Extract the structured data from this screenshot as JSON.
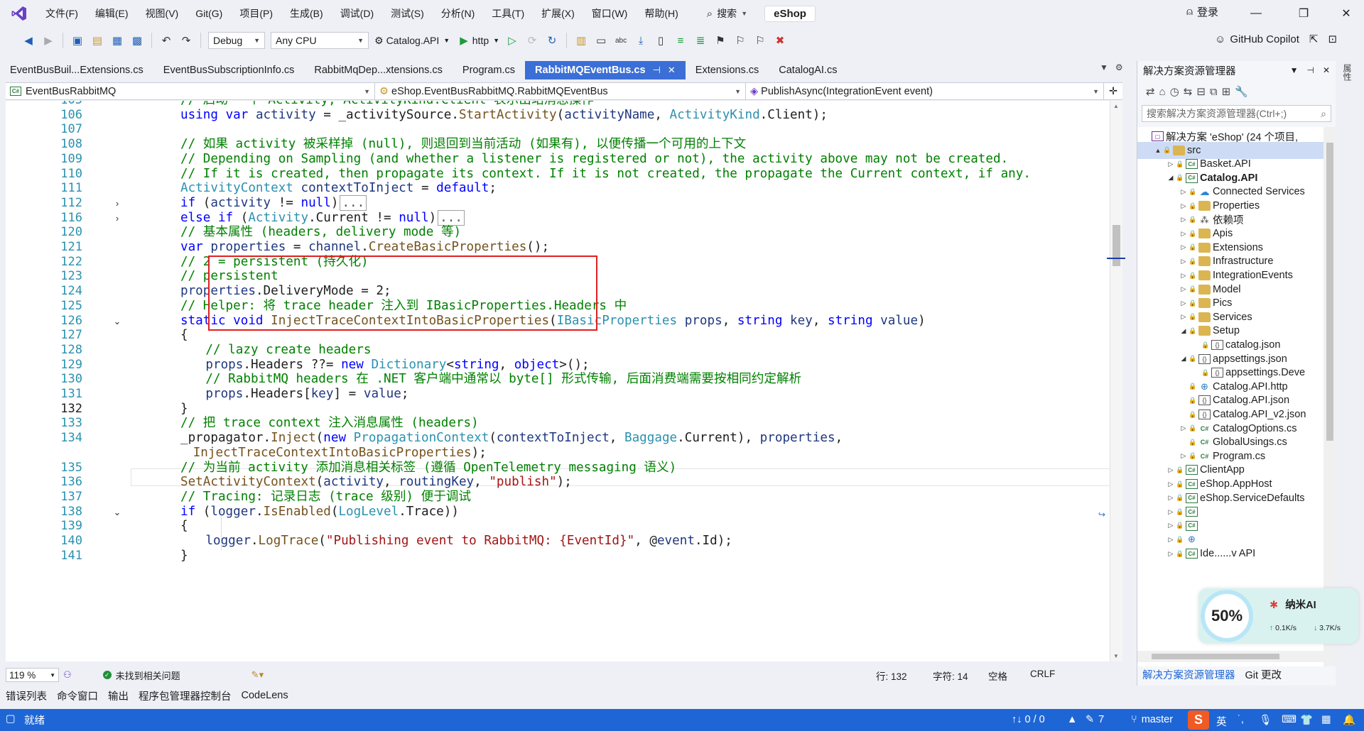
{
  "menu": [
    "文件(F)",
    "编辑(E)",
    "视图(V)",
    "Git(G)",
    "项目(P)",
    "生成(B)",
    "调试(D)",
    "测试(S)",
    "分析(N)",
    "工具(T)",
    "扩展(X)",
    "窗口(W)",
    "帮助(H)"
  ],
  "search_label": "搜索",
  "solution_name": "eShop",
  "login_label": "登录",
  "toolbar": {
    "config": "Debug",
    "platform": "Any CPU",
    "startup_project": "Catalog.API",
    "launch_profile": "http",
    "copilot_label": "GitHub Copilot"
  },
  "tabs": [
    {
      "label": "EventBusBuil...Extensions.cs",
      "active": false
    },
    {
      "label": "EventBusSubscriptionInfo.cs",
      "active": false
    },
    {
      "label": "RabbitMqDep...xtensions.cs",
      "active": false
    },
    {
      "label": "Program.cs",
      "active": false
    },
    {
      "label": "RabbitMQEventBus.cs",
      "active": true
    },
    {
      "label": "Extensions.cs",
      "active": false
    },
    {
      "label": "CatalogAI.cs",
      "active": false
    }
  ],
  "navbar": {
    "project": "EventBusRabbitMQ",
    "type": "eShop.EventBusRabbitMQ.RabbitMQEventBus",
    "member": "PublishAsync(IntegrationEvent event)"
  },
  "code_lines": [
    {
      "n": "105",
      "indent": 8,
      "fold": "",
      "tokens": [
        [
          "com",
          "// 启动 一个 Activity, ActivityKind.Client 表示出站消息操作"
        ]
      ]
    },
    {
      "n": "106",
      "indent": 8,
      "fold": "",
      "tokens": [
        [
          "kw",
          "using "
        ],
        [
          "kw",
          "var "
        ],
        [
          "var",
          "activity"
        ],
        [
          "plain",
          " = _activitySource."
        ],
        [
          "meth",
          "StartActivity"
        ],
        [
          "plain",
          "("
        ],
        [
          "var",
          "activityName"
        ],
        [
          "plain",
          ", "
        ],
        [
          "type",
          "ActivityKind"
        ],
        [
          "plain",
          ".Client);"
        ]
      ]
    },
    {
      "n": "107",
      "indent": 8,
      "fold": "",
      "tokens": []
    },
    {
      "n": "108",
      "indent": 8,
      "fold": "",
      "tokens": [
        [
          "com",
          "// 如果 activity 被采样掉 (null), 则退回到当前活动 (如果有), 以便传播一个可用的上下文"
        ]
      ]
    },
    {
      "n": "109",
      "indent": 8,
      "fold": "",
      "tokens": [
        [
          "com",
          "// Depending on Sampling (and whether a listener is registered or not), the activity above may not be created."
        ]
      ]
    },
    {
      "n": "110",
      "indent": 8,
      "fold": "",
      "tokens": [
        [
          "com",
          "// If it is created, then propagate its context. If it is not created, the propagate the Current context, if any."
        ]
      ]
    },
    {
      "n": "111",
      "indent": 8,
      "fold": "",
      "tokens": [
        [
          "type",
          "ActivityContext "
        ],
        [
          "var",
          "contextToInject"
        ],
        [
          "plain",
          " = "
        ],
        [
          "kw",
          "default"
        ],
        [
          "plain",
          ";"
        ]
      ]
    },
    {
      "n": "112",
      "indent": 8,
      "fold": "collapsed",
      "tokens": [
        [
          "kw",
          "if "
        ],
        [
          "plain",
          "("
        ],
        [
          "var",
          "activity"
        ],
        [
          "plain",
          " != "
        ],
        [
          "kw",
          "null"
        ],
        [
          "plain",
          ")"
        ],
        [
          "box",
          "..."
        ]
      ]
    },
    {
      "n": "116",
      "indent": 8,
      "fold": "collapsed",
      "tokens": [
        [
          "kw",
          "else if "
        ],
        [
          "plain",
          "("
        ],
        [
          "type",
          "Activity"
        ],
        [
          "plain",
          ".Current != "
        ],
        [
          "kw",
          "null"
        ],
        [
          "plain",
          ")"
        ],
        [
          "box",
          "..."
        ]
      ]
    },
    {
      "n": "120",
      "indent": 8,
      "fold": "",
      "tokens": [
        [
          "com",
          "// 基本属性 (headers, delivery mode 等)"
        ]
      ]
    },
    {
      "n": "121",
      "indent": 8,
      "fold": "",
      "tokens": [
        [
          "kw",
          "var "
        ],
        [
          "var",
          "properties"
        ],
        [
          "plain",
          " = "
        ],
        [
          "var",
          "channel"
        ],
        [
          "plain",
          "."
        ],
        [
          "meth",
          "CreateBasicProperties"
        ],
        [
          "plain",
          "();"
        ]
      ]
    },
    {
      "n": "122",
      "indent": 8,
      "fold": "",
      "tokens": [
        [
          "com",
          "// 2 = persistent (持久化)"
        ]
      ]
    },
    {
      "n": "123",
      "indent": 8,
      "fold": "",
      "tokens": [
        [
          "com",
          "// persistent"
        ]
      ]
    },
    {
      "n": "124",
      "indent": 8,
      "fold": "",
      "tokens": [
        [
          "var",
          "properties"
        ],
        [
          "plain",
          ".DeliveryMode = 2;"
        ]
      ]
    },
    {
      "n": "125",
      "indent": 8,
      "fold": "",
      "tokens": [
        [
          "com",
          "// Helper: 将 trace header 注入到 IBasicProperties.Headers 中"
        ]
      ]
    },
    {
      "n": "126",
      "indent": 8,
      "fold": "open",
      "tokens": [
        [
          "kw",
          "static "
        ],
        [
          "kw",
          "void "
        ],
        [
          "meth",
          "InjectTraceContextIntoBasicProperties"
        ],
        [
          "plain",
          "("
        ],
        [
          "type",
          "IBasicProperties "
        ],
        [
          "var",
          "props"
        ],
        [
          "plain",
          ", "
        ],
        [
          "kw",
          "string "
        ],
        [
          "var",
          "key"
        ],
        [
          "plain",
          ", "
        ],
        [
          "kw",
          "string "
        ],
        [
          "var",
          "value"
        ],
        [
          "plain",
          ")"
        ]
      ]
    },
    {
      "n": "127",
      "indent": 8,
      "fold": "",
      "tokens": [
        [
          "plain",
          "{"
        ]
      ]
    },
    {
      "n": "128",
      "indent": 12,
      "fold": "",
      "tokens": [
        [
          "com",
          "// lazy create headers"
        ]
      ]
    },
    {
      "n": "129",
      "indent": 12,
      "fold": "",
      "tokens": [
        [
          "var",
          "props"
        ],
        [
          "plain",
          ".Headers ??= "
        ],
        [
          "kw",
          "new "
        ],
        [
          "type",
          "Dictionary"
        ],
        [
          "plain",
          "<"
        ],
        [
          "kw",
          "string"
        ],
        [
          "plain",
          ", "
        ],
        [
          "kw",
          "object"
        ],
        [
          "plain",
          ">();"
        ]
      ]
    },
    {
      "n": "130",
      "indent": 12,
      "fold": "",
      "tokens": [
        [
          "com",
          "// RabbitMQ headers 在 .NET 客户端中通常以 byte[] 形式传输, 后面消费端需要按相同约定解析"
        ]
      ]
    },
    {
      "n": "131",
      "indent": 12,
      "fold": "",
      "tokens": [
        [
          "var",
          "props"
        ],
        [
          "plain",
          ".Headers["
        ],
        [
          "var",
          "key"
        ],
        [
          "plain",
          "] = "
        ],
        [
          "var",
          "value"
        ],
        [
          "plain",
          ";"
        ]
      ]
    },
    {
      "n": "132",
      "indent": 8,
      "fold": "",
      "current": true,
      "tokens": [
        [
          "plain",
          "}"
        ]
      ]
    },
    {
      "n": "133",
      "indent": 8,
      "fold": "",
      "tokens": [
        [
          "com",
          "// 把 trace context 注入消息属性 (headers)"
        ]
      ]
    },
    {
      "n": "134",
      "indent": 8,
      "fold": "",
      "tokens": [
        [
          "plain",
          "_propagator."
        ],
        [
          "meth",
          "Inject"
        ],
        [
          "plain",
          "("
        ],
        [
          "kw",
          "new "
        ],
        [
          "type",
          "PropagationContext"
        ],
        [
          "plain",
          "("
        ],
        [
          "var",
          "contextToInject"
        ],
        [
          "plain",
          ", "
        ],
        [
          "type",
          "Baggage"
        ],
        [
          "plain",
          ".Current), "
        ],
        [
          "var",
          "properties"
        ],
        [
          "plain",
          ","
        ]
      ]
    },
    {
      "n": "",
      "indent": 10,
      "fold": "",
      "tokens": [
        [
          "meth",
          "InjectTraceContextIntoBasicProperties"
        ],
        [
          "plain",
          ");"
        ]
      ]
    },
    {
      "n": "135",
      "indent": 8,
      "fold": "",
      "tokens": [
        [
          "com",
          "// 为当前 activity 添加消息相关标签 (遵循 OpenTelemetry messaging 语义)"
        ]
      ]
    },
    {
      "n": "136",
      "indent": 8,
      "fold": "",
      "tokens": [
        [
          "meth",
          "SetActivityContext"
        ],
        [
          "plain",
          "("
        ],
        [
          "var",
          "activity"
        ],
        [
          "plain",
          ", "
        ],
        [
          "var",
          "routingKey"
        ],
        [
          "plain",
          ", "
        ],
        [
          "str",
          "\"publish\""
        ],
        [
          "plain",
          ");"
        ]
      ]
    },
    {
      "n": "137",
      "indent": 8,
      "fold": "",
      "tokens": [
        [
          "com",
          "// Tracing: 记录日志 (trace 级别) 便于调试"
        ]
      ]
    },
    {
      "n": "138",
      "indent": 8,
      "fold": "open",
      "tokens": [
        [
          "kw",
          "if "
        ],
        [
          "plain",
          "("
        ],
        [
          "var",
          "logger"
        ],
        [
          "plain",
          "."
        ],
        [
          "meth",
          "IsEnabled"
        ],
        [
          "plain",
          "("
        ],
        [
          "type",
          "LogLevel"
        ],
        [
          "plain",
          ".Trace))"
        ]
      ]
    },
    {
      "n": "139",
      "indent": 8,
      "fold": "",
      "tokens": [
        [
          "plain",
          "{"
        ]
      ]
    },
    {
      "n": "140",
      "indent": 12,
      "fold": "",
      "tokens": [
        [
          "var",
          "logger"
        ],
        [
          "plain",
          "."
        ],
        [
          "meth",
          "LogTrace"
        ],
        [
          "plain",
          "("
        ],
        [
          "str",
          "\"Publishing event to RabbitMQ: {EventId}\""
        ],
        [
          "plain",
          ", @"
        ],
        [
          "var",
          "event"
        ],
        [
          "plain",
          ".Id);"
        ]
      ]
    },
    {
      "n": "141",
      "indent": 8,
      "fold": "",
      "tokens": [
        [
          "plain",
          "}"
        ]
      ]
    }
  ],
  "editor_status": {
    "zoom": "119 %",
    "issues": "未找到相关问题",
    "line": "行: 132",
    "char": "字符: 14",
    "whitespace": "空格",
    "eol": "CRLF"
  },
  "bottom_tabs": [
    "错误列表",
    "命令窗口",
    "输出",
    "程序包管理器控制台",
    "CodeLens"
  ],
  "statusbar": {
    "ready": "就绪",
    "sync": "↑↓ 0 / 0",
    "edits": "7",
    "branch": "master"
  },
  "solution_explorer": {
    "title": "解决方案资源管理器",
    "search_placeholder": "搜索解决方案资源管理器(Ctrl+;)",
    "items": [
      {
        "label": "解决方案 'eShop' (24 个项目,",
        "depth": 0,
        "arrow": "",
        "icon": "sln"
      },
      {
        "label": "src",
        "depth": 1,
        "arrow": "▲",
        "icon": "folder",
        "selected": true
      },
      {
        "label": "Basket.API",
        "depth": 2,
        "arrow": "▷",
        "icon": "project"
      },
      {
        "label": "Catalog.API",
        "depth": 2,
        "arrow": "◢",
        "icon": "project",
        "bold": true
      },
      {
        "label": "Connected Services",
        "depth": 3,
        "arrow": "▷",
        "icon": "conn"
      },
      {
        "label": "Properties",
        "depth": 3,
        "arrow": "▷",
        "icon": "folder"
      },
      {
        "label": "依赖项",
        "depth": 3,
        "arrow": "▷",
        "icon": "ref"
      },
      {
        "label": "Apis",
        "depth": 3,
        "arrow": "▷",
        "icon": "folder"
      },
      {
        "label": "Extensions",
        "depth": 3,
        "arrow": "▷",
        "icon": "folder"
      },
      {
        "label": "Infrastructure",
        "depth": 3,
        "arrow": "▷",
        "icon": "folder"
      },
      {
        "label": "IntegrationEvents",
        "depth": 3,
        "arrow": "▷",
        "icon": "folder"
      },
      {
        "label": "Model",
        "depth": 3,
        "arrow": "▷",
        "icon": "folder"
      },
      {
        "label": "Pics",
        "depth": 3,
        "arrow": "▷",
        "icon": "folder"
      },
      {
        "label": "Services",
        "depth": 3,
        "arrow": "▷",
        "icon": "folder"
      },
      {
        "label": "Setup",
        "depth": 3,
        "arrow": "◢",
        "icon": "folder"
      },
      {
        "label": "catalog.json",
        "depth": 4,
        "arrow": "",
        "icon": "json"
      },
      {
        "label": "appsettings.json",
        "depth": 3,
        "arrow": "◢",
        "icon": "json"
      },
      {
        "label": "appsettings.Deve",
        "depth": 4,
        "arrow": "",
        "icon": "json"
      },
      {
        "label": "Catalog.API.http",
        "depth": 3,
        "arrow": "",
        "icon": "globe"
      },
      {
        "label": "Catalog.API.json",
        "depth": 3,
        "arrow": "",
        "icon": "json"
      },
      {
        "label": "Catalog.API_v2.json",
        "depth": 3,
        "arrow": "",
        "icon": "json"
      },
      {
        "label": "CatalogOptions.cs",
        "depth": 3,
        "arrow": "▷",
        "icon": "cs"
      },
      {
        "label": "GlobalUsings.cs",
        "depth": 3,
        "arrow": "",
        "icon": "cs"
      },
      {
        "label": "Program.cs",
        "depth": 3,
        "arrow": "▷",
        "icon": "cs"
      },
      {
        "label": "ClientApp",
        "depth": 2,
        "arrow": "▷",
        "icon": "project"
      },
      {
        "label": "eShop.AppHost",
        "depth": 2,
        "arrow": "▷",
        "icon": "project"
      },
      {
        "label": "eShop.ServiceDefaults",
        "depth": 2,
        "arrow": "▷",
        "icon": "project"
      },
      {
        "label": "",
        "depth": 2,
        "arrow": "▷",
        "icon": "project"
      },
      {
        "label": "",
        "depth": 2,
        "arrow": "▷",
        "icon": "project"
      },
      {
        "label": "",
        "depth": 2,
        "arrow": "▷",
        "icon": "globe"
      },
      {
        "label": "Ide......v API",
        "depth": 2,
        "arrow": "▷",
        "icon": "project"
      }
    ],
    "bottom_tabs": [
      "解决方案资源管理器",
      "Git 更改"
    ]
  },
  "net_widget": {
    "percent": "50%",
    "name": "纳米AI",
    "up": "0.1K/s",
    "down": "3.7K/s"
  }
}
